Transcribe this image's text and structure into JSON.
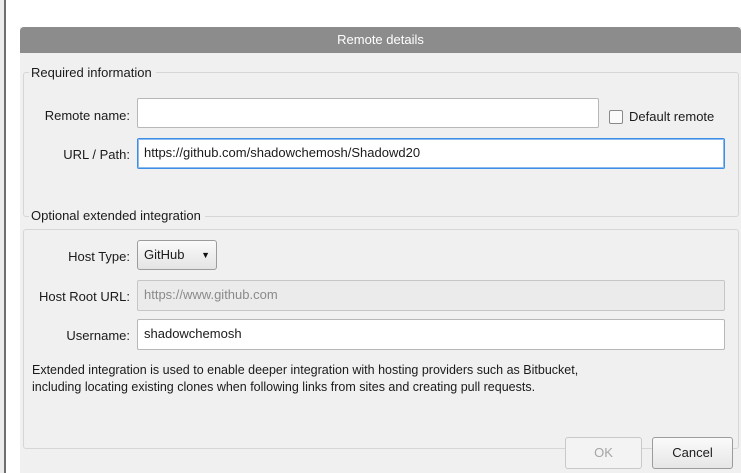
{
  "dialog": {
    "title": "Remote details"
  },
  "required": {
    "legend": "Required information",
    "remote_name_label": "Remote name:",
    "remote_name_value": "",
    "default_remote_label": "Default remote",
    "default_remote_checked": false,
    "url_label": "URL / Path:",
    "url_value": "https://github.com/shadowchemosh/Shadowd20"
  },
  "optional": {
    "legend": "Optional extended integration",
    "host_type_label": "Host Type:",
    "host_type_value": "GitHub",
    "host_root_label": "Host Root URL:",
    "host_root_value": "https://www.github.com",
    "username_label": "Username:",
    "username_value": "shadowchemosh",
    "description_line1": "Extended integration is used to enable deeper integration with hosting providers such as Bitbucket,",
    "description_line2": "including locating existing clones when following links from sites and creating pull requests."
  },
  "buttons": {
    "ok_label": "OK",
    "cancel_label": "Cancel"
  }
}
